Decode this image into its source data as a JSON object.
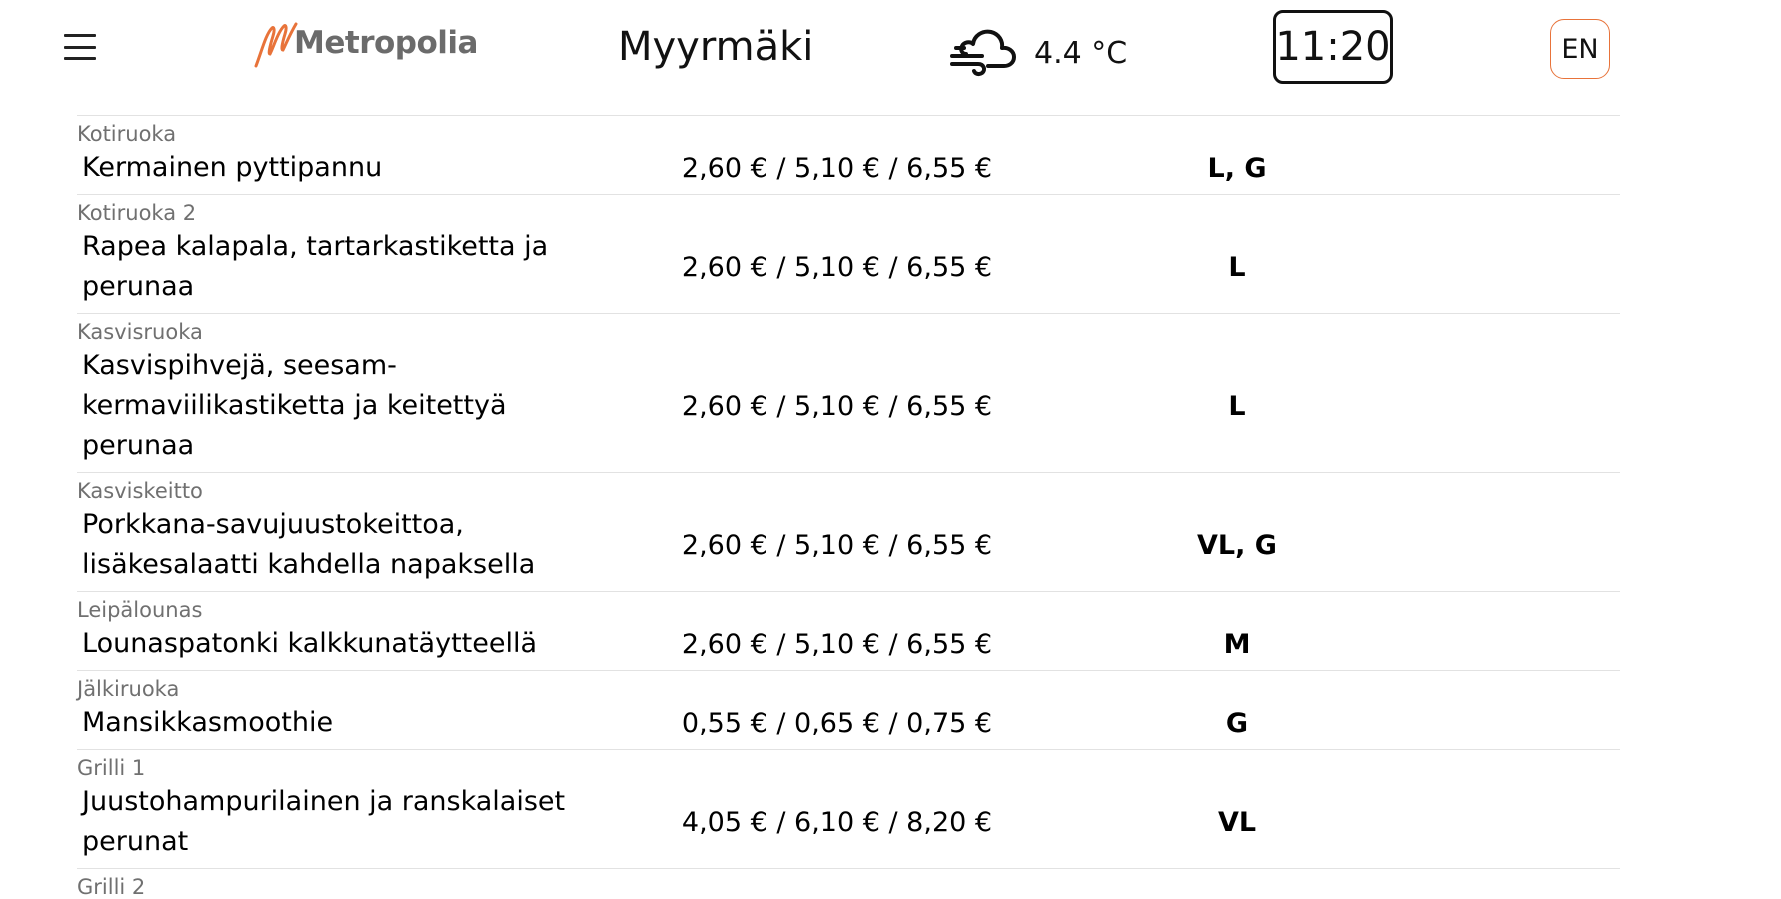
{
  "header": {
    "logo_text": "Metropolia",
    "location": "Myyrmäki",
    "weather_icon": "wind-cloud-icon",
    "temperature": "4.4 °C",
    "time": "11:20",
    "language": "EN",
    "accent_color": "#e8733a"
  },
  "menu": {
    "items": [
      {
        "category": "Kotiruoka",
        "dish": "Kermainen pyttipannu",
        "price": "2,60 € / 5,10 € / 6,55 €",
        "diet": "L, G"
      },
      {
        "category": "Kotiruoka 2",
        "dish": "Rapea kalapala, tartarkastiketta ja perunaa",
        "price": "2,60 € / 5,10 € / 6,55 €",
        "diet": "L"
      },
      {
        "category": "Kasvisruoka",
        "dish": "Kasvispihvejä, seesam-kermaviilikastiketta ja keitettyä perunaa",
        "price": "2,60 € / 5,10 € / 6,55 €",
        "diet": "L"
      },
      {
        "category": "Kasviskeitto",
        "dish": "Porkkana-savujuustokeittoa, lisäkesalaatti kahdella napaksella",
        "price": "2,60 € / 5,10 € / 6,55 €",
        "diet": "VL, G"
      },
      {
        "category": "Leipälounas",
        "dish": "Lounaspatonki kalkkunatäytteellä",
        "price": "2,60 € / 5,10 € / 6,55 €",
        "diet": "M"
      },
      {
        "category": "Jälkiruoka",
        "dish": "Mansikkasmoothie",
        "price": "0,55 € / 0,65 € / 0,75 €",
        "diet": "G"
      },
      {
        "category": "Grilli 1",
        "dish": "Juustohampurilainen ja ranskalaiset perunat",
        "price": "4,05 € / 6,10 € / 8,20 €",
        "diet": "VL"
      },
      {
        "category": "Grilli 2"
      }
    ]
  }
}
